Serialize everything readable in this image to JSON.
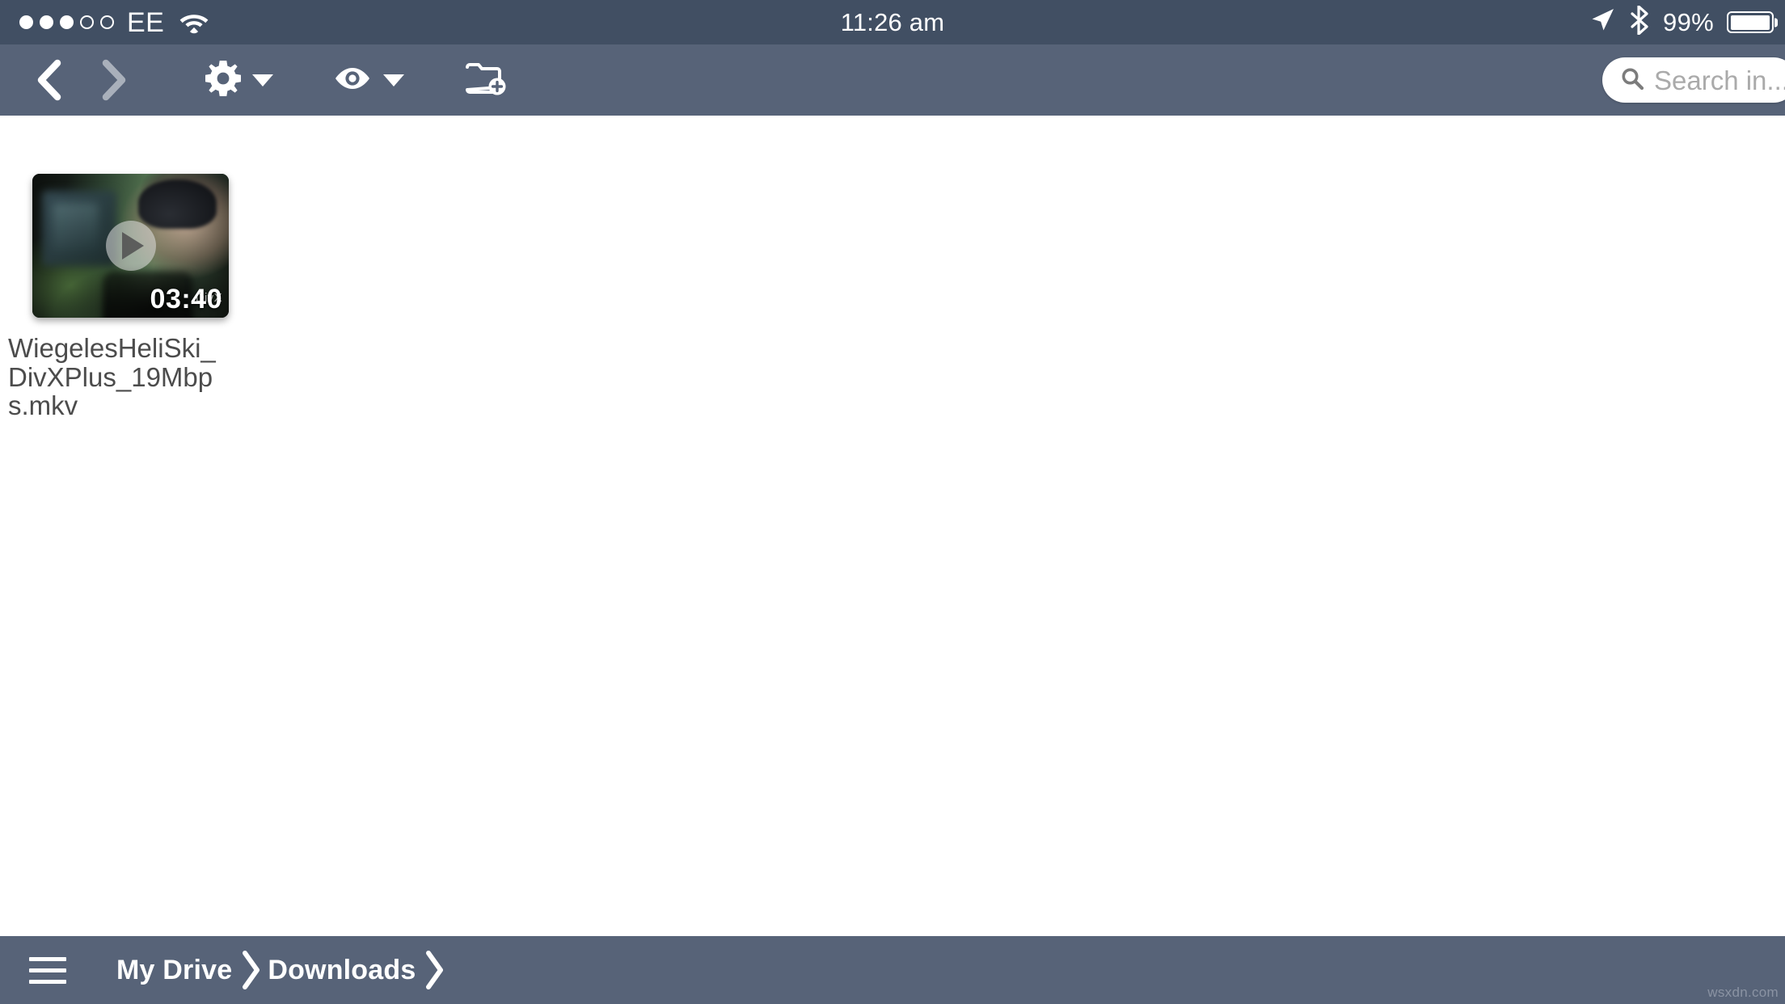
{
  "status_bar": {
    "signal_dots_total": 5,
    "signal_dots_filled": 3,
    "carrier": "EE",
    "wifi_icon": "wifi-icon",
    "time": "11:26 am",
    "location_icon": "location-arrow-icon",
    "bluetooth_icon": "bluetooth-icon",
    "battery_percent": "99%",
    "battery_level": 99,
    "colors": {
      "background": "#414f63",
      "foreground": "#ffffff"
    }
  },
  "toolbar": {
    "back_label": "Back",
    "back_icon": "chevron-left-icon",
    "back_enabled": true,
    "forward_label": "Forward",
    "forward_icon": "chevron-right-icon",
    "forward_enabled": false,
    "settings_label": "Settings",
    "settings_icon": "gear-icon",
    "settings_caret_icon": "caret-down-icon",
    "view_label": "View",
    "view_icon": "eye-icon",
    "view_caret_icon": "caret-down-icon",
    "new_folder_label": "New Folder",
    "new_folder_icon": "folder-plus-icon",
    "colors": {
      "background": "#576378",
      "icon": "#ffffff",
      "icon_disabled": "#a9b0bb"
    }
  },
  "search": {
    "icon": "search-icon",
    "placeholder": "Search in...",
    "value": ""
  },
  "content": {
    "files": [
      {
        "name": "WiegelesHeliSki_DivXPlus_19Mbps.mkv",
        "type": "video",
        "duration": "03:40",
        "play_icon": "play-icon",
        "thumbnail_watermark": "DivX"
      }
    ]
  },
  "bottom_bar": {
    "menu_icon": "hamburger-menu-icon",
    "menu_label": "Menu",
    "breadcrumbs": [
      {
        "label": "My Drive",
        "separator_icon": "chevron-right-icon"
      },
      {
        "label": "Downloads",
        "separator_icon": "chevron-right-icon"
      }
    ],
    "colors": {
      "background": "#576378",
      "text": "#ffffff"
    }
  },
  "watermark": "wsxdn.com"
}
